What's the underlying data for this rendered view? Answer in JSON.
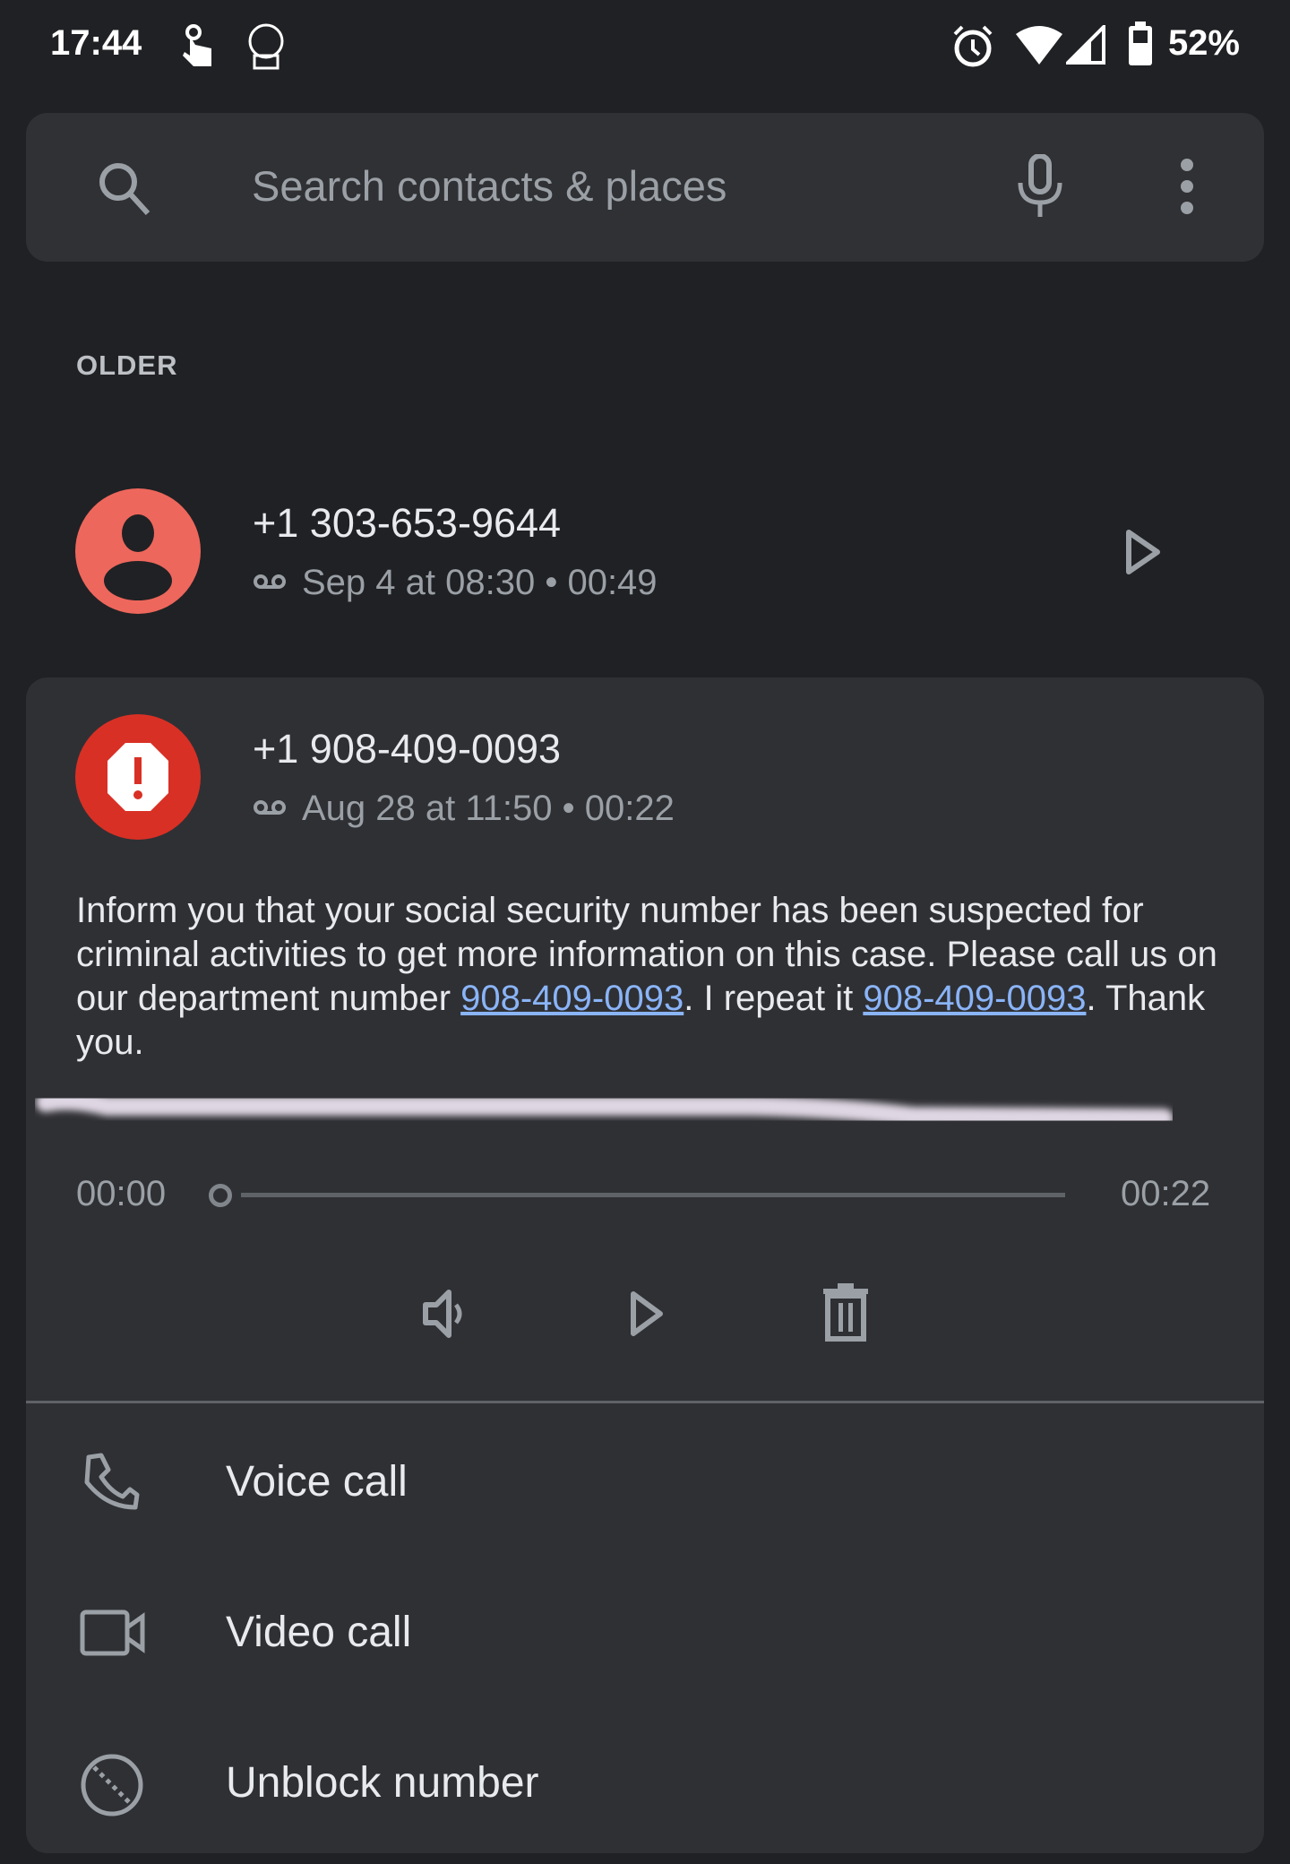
{
  "status_bar": {
    "time": "17:44",
    "battery": "52%",
    "icons": [
      "touch-icon",
      "app-icon",
      "alarm-icon",
      "wifi-icon",
      "signal-icon",
      "battery-icon"
    ]
  },
  "search": {
    "placeholder": "Search contacts & places",
    "icons": [
      "search-icon",
      "mic-icon",
      "more-vert-icon"
    ]
  },
  "section_label": "OLDER",
  "calls": [
    {
      "number": "+1 303-653-9644",
      "detail": "Sep 4 at 08:30 • 00:49",
      "avatar_color": "#ee675c",
      "avatar_icon": "person-icon"
    },
    {
      "number": "+1 908-409-0093",
      "detail": "Aug 28 at 11:50 • 00:22",
      "avatar_color": "#d93025",
      "avatar_icon": "blocked-icon",
      "transcript": {
        "part1": "Inform you that your social security number has been suspected for criminal activities to get more information on this case. Please call us on our department number ",
        "link1": "908-409-0093",
        "part2": ". I repeat it ",
        "link2": "908-409-0093",
        "part3": ". Thank you."
      },
      "player": {
        "elapsed": "00:00",
        "duration": "00:22",
        "progress": 0
      },
      "actions": [
        {
          "label": "Voice call",
          "icon": "phone-icon"
        },
        {
          "label": "Video call",
          "icon": "video-icon"
        },
        {
          "label": "Unblock number",
          "icon": "unblock-icon"
        }
      ]
    }
  ],
  "colors": {
    "background": "#202124",
    "card": "#2f3034",
    "link": "#8ab4f8"
  }
}
